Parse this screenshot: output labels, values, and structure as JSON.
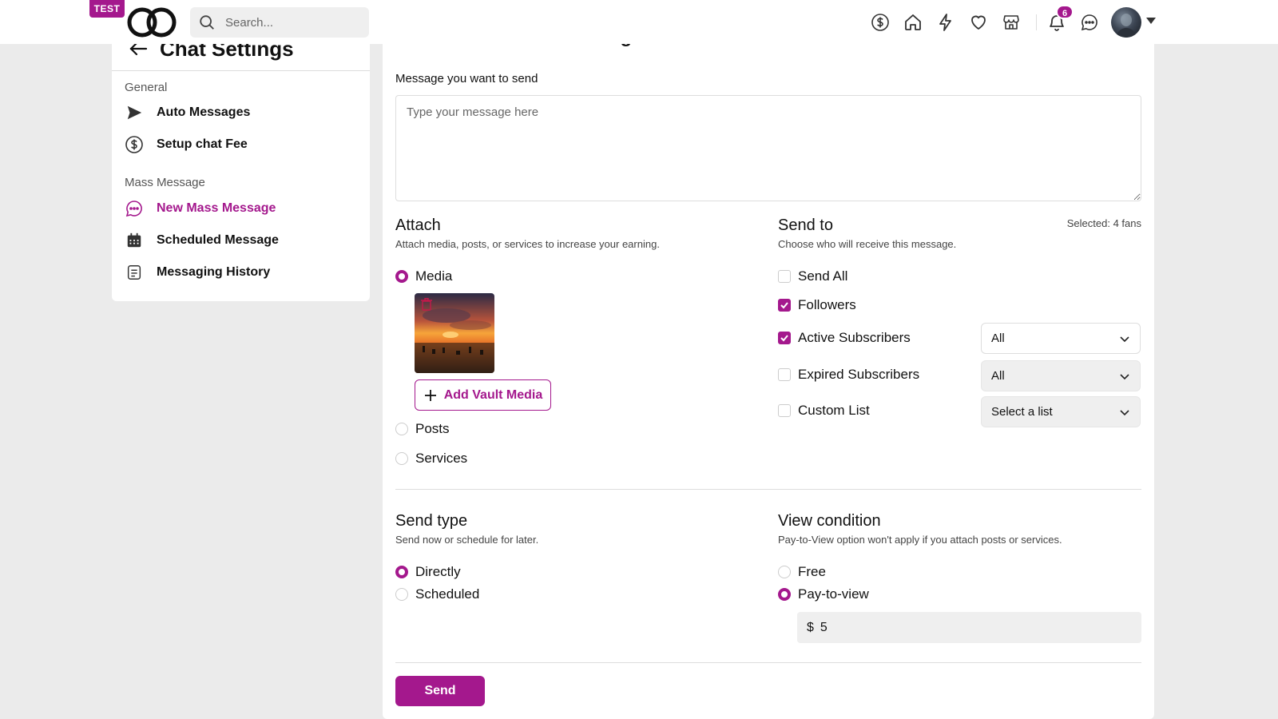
{
  "topbar": {
    "test_badge": "TEST",
    "search_placeholder": "Search...",
    "notifications_count": "6",
    "icons": [
      "dollar-icon",
      "home-icon",
      "lightning-icon",
      "heart-icon",
      "store-icon",
      "bell-icon",
      "chat-icon"
    ]
  },
  "sidebar": {
    "title": "Chat Settings",
    "sections": [
      {
        "label": "General",
        "items": [
          {
            "label": "Auto Messages",
            "icon": "send-icon"
          },
          {
            "label": "Setup chat Fee",
            "icon": "dollar-circle-icon"
          }
        ]
      },
      {
        "label": "Mass Message",
        "items": [
          {
            "label": "New Mass Message",
            "icon": "chat-dots-icon",
            "active": true
          },
          {
            "label": "Scheduled Message",
            "icon": "calendar-icon"
          },
          {
            "label": "Messaging History",
            "icon": "document-icon"
          }
        ]
      }
    ]
  },
  "main": {
    "title": "Send a new mass message",
    "message_label": "Message you want to send",
    "message_placeholder": "Type your message here",
    "attach": {
      "title": "Attach",
      "subtitle": "Attach media, posts, or services to increase your earning.",
      "options": [
        "Media",
        "Posts",
        "Services"
      ],
      "selected": "Media",
      "add_vault_label": "Add Vault Media"
    },
    "send_to": {
      "title": "Send to",
      "subtitle": "Choose who will receive this message.",
      "selected_count": "Selected: 4 fans",
      "options": [
        {
          "label": "Send All",
          "checked": false
        },
        {
          "label": "Followers",
          "checked": true
        },
        {
          "label": "Active Subscribers",
          "checked": true,
          "select": "All"
        },
        {
          "label": "Expired Subscribers",
          "checked": false,
          "select": "All"
        },
        {
          "label": "Custom List",
          "checked": false,
          "select": "Select a list"
        }
      ]
    },
    "send_type": {
      "title": "Send type",
      "subtitle": "Send now or schedule for later.",
      "options": [
        "Directly",
        "Scheduled"
      ],
      "selected": "Directly"
    },
    "view_condition": {
      "title": "View condition",
      "subtitle": "Pay-to-View option won't apply if you attach posts or services.",
      "options": [
        "Free",
        "Pay-to-view"
      ],
      "selected": "Pay-to-view",
      "currency": "$",
      "price": "5"
    },
    "send_label": "Send"
  },
  "colors": {
    "accent": "#a4188d",
    "background": "#ebebeb"
  }
}
